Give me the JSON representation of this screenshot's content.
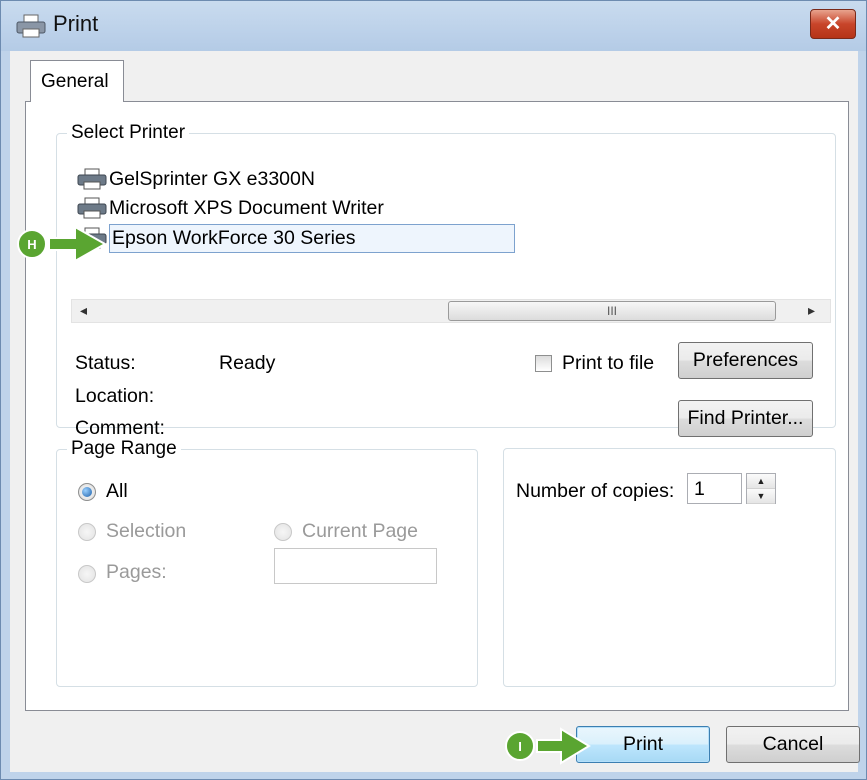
{
  "window": {
    "title": "Print"
  },
  "tabs": [
    {
      "label": "General"
    }
  ],
  "select_printer": {
    "legend": "Select Printer",
    "printers": [
      {
        "name": "GelSprinter GX e3300N",
        "selected": false
      },
      {
        "name": "Microsoft XPS Document Writer",
        "selected": false
      },
      {
        "name": "Epson WorkForce 30 Series",
        "selected": true
      }
    ],
    "scrollbar": {
      "thumb_grip": "III"
    },
    "status_label": "Status:",
    "status_value": "Ready",
    "location_label": "Location:",
    "comment_label": "Comment:",
    "print_to_file_label": "Print to file",
    "print_to_file_checked": false,
    "preferences_label": "Preferences",
    "find_printer_label": "Find Printer..."
  },
  "page_range": {
    "legend": "Page Range",
    "all_label": "All",
    "selection_label": "Selection",
    "current_page_label": "Current Page",
    "pages_label": "Pages:",
    "selected_option": "All",
    "pages_value": ""
  },
  "copies": {
    "label": "Number of copies:",
    "value": "1"
  },
  "buttons": {
    "print_label": "Print",
    "cancel_label": "Cancel"
  },
  "callouts": {
    "h_letter": "H",
    "i_letter": "I"
  },
  "colors": {
    "callout_green": "#5aa531",
    "selection_blue": "#7da2ce",
    "close_red": "#c8452a"
  },
  "icons": {
    "title": "printer-icon",
    "close": "close-icon"
  }
}
